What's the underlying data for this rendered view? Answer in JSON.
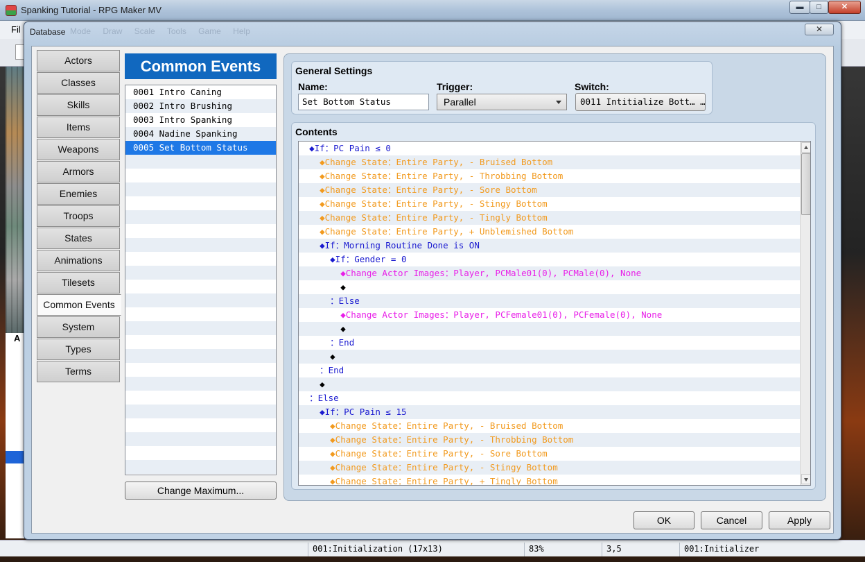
{
  "app": {
    "title": "Spanking Tutorial - RPG Maker MV",
    "menu_first": "Fil",
    "left_tab": "A",
    "window_buttons": {
      "minimize": "▬",
      "maximize": "□",
      "close": "✕"
    }
  },
  "dialog": {
    "title": "Database",
    "close_glyph": "✕",
    "ghost_menu": "Mode Draw Scale Tools Game Help"
  },
  "tabs": [
    "Actors",
    "Classes",
    "Skills",
    "Items",
    "Weapons",
    "Armors",
    "Enemies",
    "Troops",
    "States",
    "Animations",
    "Tilesets",
    "Common Events",
    "System",
    "Types",
    "Terms"
  ],
  "active_tab": "Common Events",
  "common_events": {
    "header": "Common Events",
    "items": [
      "0001 Intro Caning",
      "0002 Intro Brushing",
      "0003 Intro Spanking",
      "0004 Nadine Spanking",
      "0005 Set Bottom Status"
    ],
    "selected": "0005 Set Bottom Status",
    "change_maximum_label": "Change Maximum..."
  },
  "general": {
    "title": "General Settings",
    "name_label": "Name:",
    "name_value": "Set Bottom Status",
    "trigger_label": "Trigger:",
    "trigger_value": "Parallel",
    "switch_label": "Switch:",
    "switch_value": "0011 Intitialize Bott… …"
  },
  "contents": {
    "title": "Contents",
    "lines": [
      {
        "indent": "  ",
        "text": "◆If：PC Pain ≤ 0",
        "color": "blue"
      },
      {
        "indent": "    ",
        "text": "◆Change State：Entire Party, - Bruised Bottom",
        "color": "orange"
      },
      {
        "indent": "    ",
        "text": "◆Change State：Entire Party, - Throbbing Bottom",
        "color": "orange"
      },
      {
        "indent": "    ",
        "text": "◆Change State：Entire Party, - Sore Bottom",
        "color": "orange"
      },
      {
        "indent": "    ",
        "text": "◆Change State：Entire Party, - Stingy Bottom",
        "color": "orange"
      },
      {
        "indent": "    ",
        "text": "◆Change State：Entire Party, - Tingly Bottom",
        "color": "orange"
      },
      {
        "indent": "    ",
        "text": "◆Change State：Entire Party, + Unblemished Bottom",
        "color": "orange"
      },
      {
        "indent": "    ",
        "text": "◆If：Morning Routine Done is ON",
        "color": "blue"
      },
      {
        "indent": "      ",
        "text": "◆If：Gender = 0",
        "color": "blue"
      },
      {
        "indent": "        ",
        "text": "◆Change Actor Images：Player, PCMale01(0), PCMale(0), None",
        "color": "magenta"
      },
      {
        "indent": "        ",
        "text": "◆",
        "color": "black"
      },
      {
        "indent": "      ",
        "text": "：Else",
        "color": "blue"
      },
      {
        "indent": "        ",
        "text": "◆Change Actor Images：Player, PCFemale01(0), PCFemale(0), None",
        "color": "magenta"
      },
      {
        "indent": "        ",
        "text": "◆",
        "color": "black"
      },
      {
        "indent": "      ",
        "text": "：End",
        "color": "blue"
      },
      {
        "indent": "      ",
        "text": "◆",
        "color": "black"
      },
      {
        "indent": "    ",
        "text": "：End",
        "color": "blue"
      },
      {
        "indent": "    ",
        "text": "◆",
        "color": "black"
      },
      {
        "indent": "  ",
        "text": "：Else",
        "color": "blue"
      },
      {
        "indent": "    ",
        "text": "◆If：PC Pain ≤ 15",
        "color": "blue"
      },
      {
        "indent": "      ",
        "text": "◆Change State：Entire Party, - Bruised Bottom",
        "color": "orange"
      },
      {
        "indent": "      ",
        "text": "◆Change State：Entire Party, - Throbbing Bottom",
        "color": "orange"
      },
      {
        "indent": "      ",
        "text": "◆Change State：Entire Party, - Sore Bottom",
        "color": "orange"
      },
      {
        "indent": "      ",
        "text": "◆Change State：Entire Party, - Stingy Bottom",
        "color": "orange"
      },
      {
        "indent": "      ",
        "text": "◆Change State：Entire Party, + Tingly Bottom",
        "color": "orange"
      }
    ]
  },
  "buttons": {
    "ok": "OK",
    "cancel": "Cancel",
    "apply": "Apply"
  },
  "status": {
    "map": "001:Initialization (17x13)",
    "zoom": "83%",
    "coords": "3,5",
    "event": "001:Initializer"
  },
  "colors": {
    "header_blue": "#1168bf",
    "selection_blue": "#1e78e6",
    "cmd_blue": "#1a1ad0",
    "cmd_orange": "#f29a1e",
    "cmd_magenta": "#e81ee8"
  }
}
